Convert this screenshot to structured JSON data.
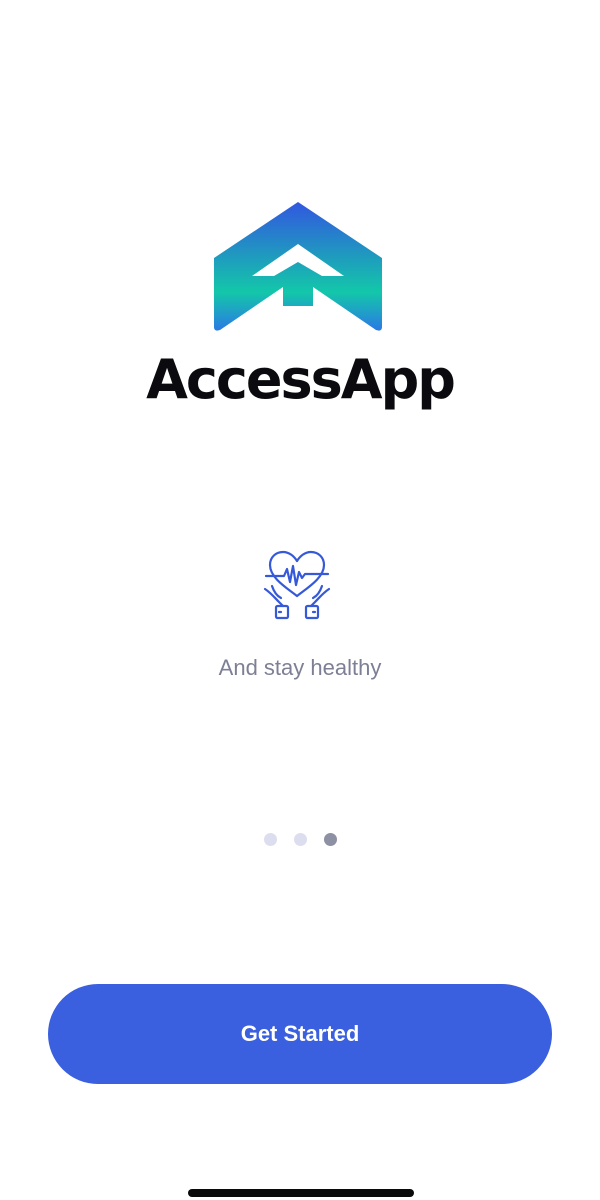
{
  "app": {
    "name": "AccessApp",
    "logo_icon": "house-arrow-logo-icon"
  },
  "onboarding": {
    "icon": "heart-in-hands-icon",
    "tagline": "And stay healthy",
    "page_count": 3,
    "current_page": 3
  },
  "actions": {
    "get_started_label": "Get Started"
  },
  "colors": {
    "brand_blue": "#3a5fdf",
    "brand_teal": "#13c7a9",
    "text_muted": "#7d7f95",
    "dot_inactive": "#dcdef0",
    "dot_active": "#8e90a3"
  }
}
